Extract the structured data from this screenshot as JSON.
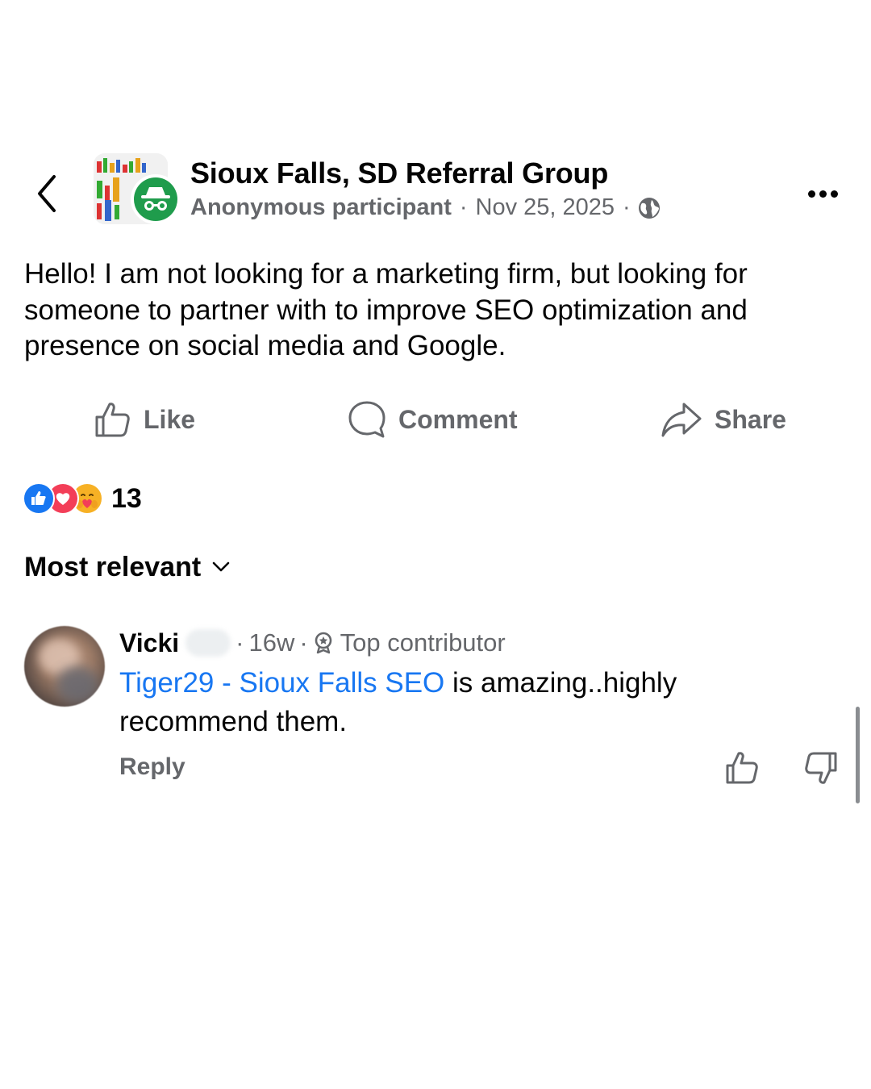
{
  "header": {
    "group_name": "Sioux Falls, SD Referral Group",
    "author": "Anonymous participant",
    "separator": "·",
    "date": "Nov 25, 2025",
    "icons": {
      "back": "chevron-left-icon",
      "more": "more-horizontal-icon",
      "audience": "globe-icon",
      "anonymous": "incognito-icon"
    }
  },
  "post": {
    "text": "Hello! I am not looking for a marketing firm, but looking for someone to partner with to improve SEO optimization and presence on social media and Google."
  },
  "actions": {
    "like": "Like",
    "comment": "Comment",
    "share": "Share"
  },
  "reactions": {
    "types": [
      "like",
      "love",
      "care"
    ],
    "count": "13"
  },
  "sort": {
    "label": "Most relevant"
  },
  "comments": [
    {
      "author_first": "Vicki",
      "time": "16w",
      "badge": "Top contributor",
      "link_text": "Tiger29 - Sioux Falls SEO",
      "text": " is amazing..highly recommend them.",
      "reply_label": "Reply"
    }
  ],
  "colors": {
    "text_primary": "#050505",
    "text_secondary": "#65676b",
    "link": "#1877f2",
    "like_reaction": "#1877f2",
    "love_reaction": "#f33e58",
    "care_reaction": "#f7b125",
    "anonymous_badge": "#1f9c4c"
  }
}
